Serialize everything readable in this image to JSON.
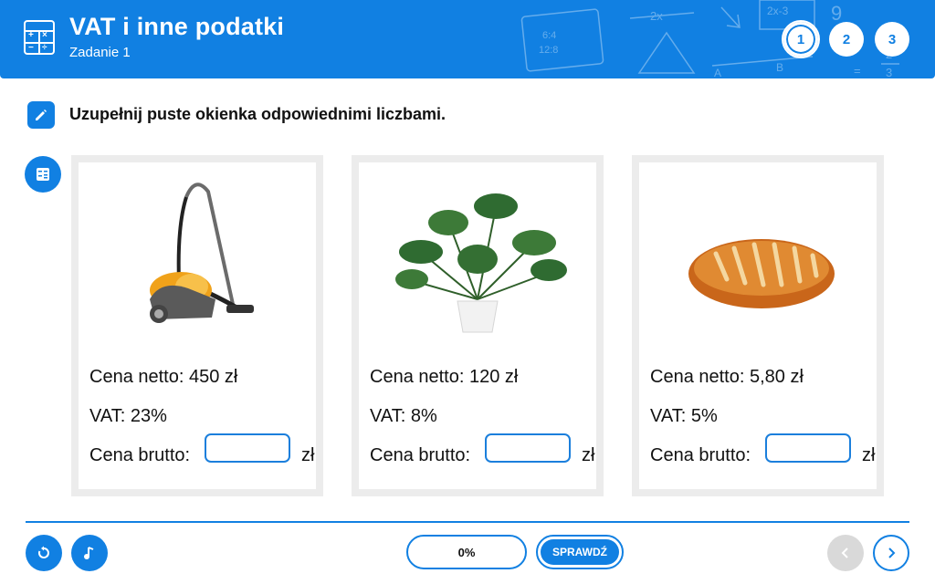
{
  "header": {
    "title": "VAT i inne podatki",
    "subtitle": "Zadanie 1",
    "steps": [
      "1",
      "2",
      "3"
    ],
    "active_step": "1"
  },
  "instruction": "Uzupełnij puste okienka odpowiednimi liczbami.",
  "cards": [
    {
      "image_icon": "vacuum-cleaner",
      "net_price": "Cena netto: 450 zł",
      "vat": "VAT: 23%",
      "gross_label": "Cena brutto:",
      "gross_value": "",
      "unit": "zł"
    },
    {
      "image_icon": "potted-plant",
      "net_price": "Cena netto: 120 zł",
      "vat": "VAT: 8%",
      "gross_label": "Cena brutto:",
      "gross_value": "",
      "unit": "zł"
    },
    {
      "image_icon": "bread-loaf",
      "net_price": "Cena netto: 5,80 zł",
      "vat": "VAT: 5%",
      "gross_label": "Cena brutto:",
      "gross_value": "",
      "unit": "zł"
    }
  ],
  "footer": {
    "progress": "0%",
    "check_label": "SPRAWDŹ"
  },
  "colors": {
    "accent": "#1180e2",
    "card_border": "#ececec",
    "disabled": "#d9d9d9"
  }
}
